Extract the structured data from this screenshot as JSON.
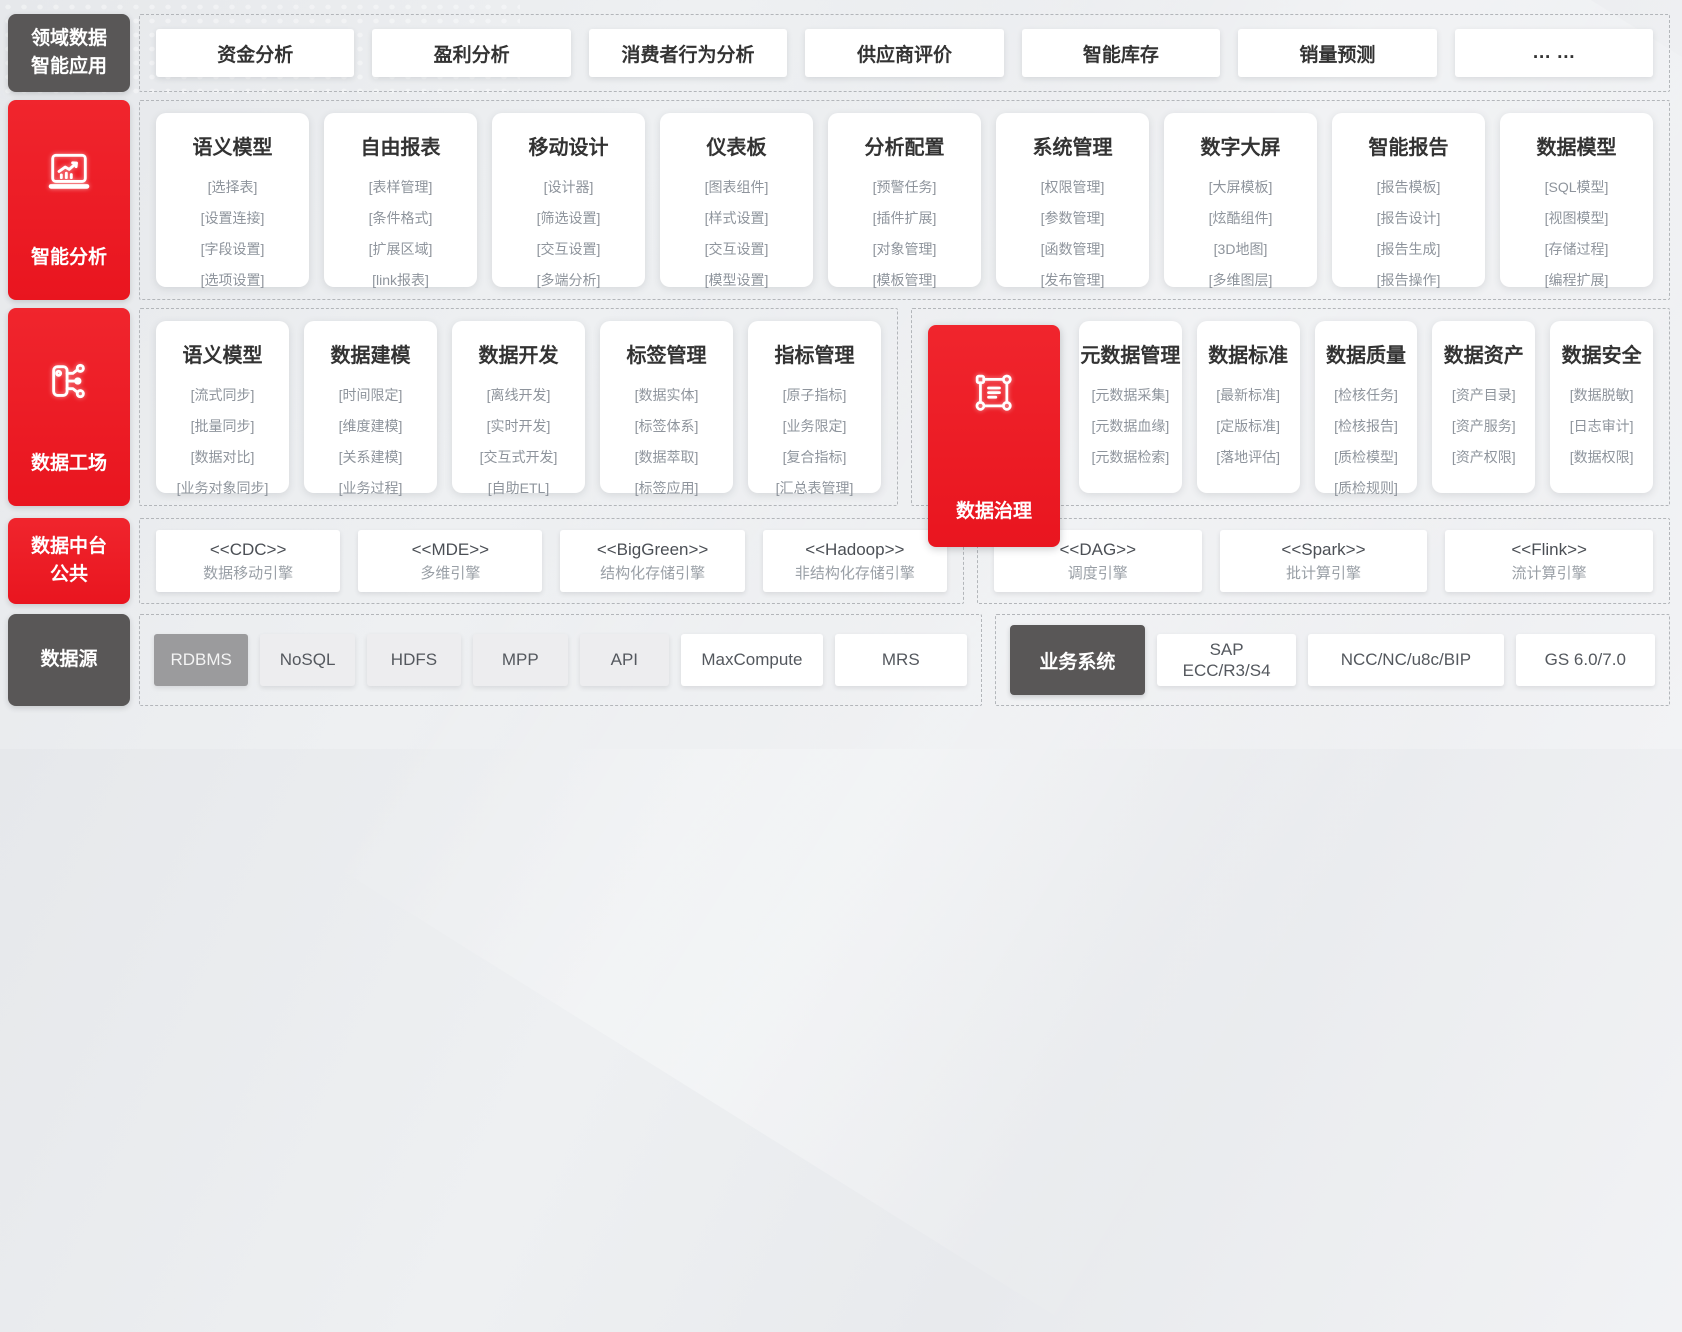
{
  "palette": {
    "accent_red": "#ec1c24",
    "dark_gray": "#595757",
    "source_highlight_gray": "#9b9b9d",
    "dashed_border": "#b3b6ba"
  },
  "app_row": {
    "label": "领域数据\n智能应用",
    "items": [
      "资金分析",
      "盈利分析",
      "消费者行为分析",
      "供应商评价",
      "智能库存",
      "销量预测",
      "… …"
    ]
  },
  "analysis_row": {
    "label": "智能分析",
    "icon": "analysis-chart-icon",
    "cards": [
      {
        "title": "语义模型",
        "items": [
          "[选择表]",
          "[设置连接]",
          "[字段设置]",
          "[选项设置]"
        ]
      },
      {
        "title": "自由报表",
        "items": [
          "[表样管理]",
          "[条件格式]",
          "[扩展区域]",
          "[link报表]"
        ]
      },
      {
        "title": "移动设计",
        "items": [
          "[设计器]",
          "[筛选设置]",
          "[交互设置]",
          "[多端分析]"
        ]
      },
      {
        "title": "仪表板",
        "items": [
          "[图表组件]",
          "[样式设置]",
          "[交互设置]",
          "[模型设置]"
        ]
      },
      {
        "title": "分析配置",
        "items": [
          "[预警任务]",
          "[插件扩展]",
          "[对象管理]",
          "[模板管理]"
        ]
      },
      {
        "title": "系统管理",
        "items": [
          "[权限管理]",
          "[参数管理]",
          "[函数管理]",
          "[发布管理]"
        ]
      },
      {
        "title": "数字大屏",
        "items": [
          "[大屏模板]",
          "[炫酷组件]",
          "[3D地图]",
          "[多维图层]"
        ]
      },
      {
        "title": "智能报告",
        "items": [
          "[报告模板]",
          "[报告设计]",
          "[报告生成]",
          "[报告操作]"
        ]
      },
      {
        "title": "数据模型",
        "items": [
          "[SQL模型]",
          "[视图模型]",
          "[存储过程]",
          "[编程扩展]"
        ]
      }
    ]
  },
  "factory_row": {
    "label": "数据工场",
    "icon": "data-factory-icon",
    "left_cards": [
      {
        "title": "语义模型",
        "items": [
          "[流式同步]",
          "[批量同步]",
          "[数据对比]",
          "[业务对象同步]"
        ]
      },
      {
        "title": "数据建模",
        "items": [
          "[时间限定]",
          "[维度建模]",
          "[关系建模]",
          "[业务过程]"
        ]
      },
      {
        "title": "数据开发",
        "items": [
          "[离线开发]",
          "[实时开发]",
          "[交互式开发]",
          "[自助ETL]"
        ]
      },
      {
        "title": "标签管理",
        "items": [
          "[数据实体]",
          "[标签体系]",
          "[数据萃取]",
          "[标签应用]"
        ]
      },
      {
        "title": "指标管理",
        "items": [
          "[原子指标]",
          "[业务限定]",
          "[复合指标]",
          "[汇总表管理]"
        ]
      }
    ],
    "governance_label": "数据治理",
    "governance_icon": "data-governance-icon",
    "right_cards": [
      {
        "title": "元数据管理",
        "items": [
          "[元数据采集]",
          "[元数据血缘]",
          "[元数据检索]"
        ]
      },
      {
        "title": "数据标准",
        "items": [
          "[最新标准]",
          "[定版标准]",
          "[落地评估]"
        ]
      },
      {
        "title": "数据质量",
        "items": [
          "[检核任务]",
          "[检核报告]",
          "[质检模型]",
          "[质检规则]"
        ]
      },
      {
        "title": "数据资产",
        "items": [
          "[资产目录]",
          "[资产服务]",
          "[资产权限]"
        ]
      },
      {
        "title": "数据安全",
        "items": [
          "[数据脱敏]",
          "[日志审计]",
          "[数据权限]"
        ]
      }
    ]
  },
  "platform_row": {
    "label": "数据中台\n公共",
    "left_engines": [
      {
        "name": "<<CDC>>",
        "desc": "数据移动引擎"
      },
      {
        "name": "<<MDE>>",
        "desc": "多维引擎"
      },
      {
        "name": "<<BigGreen>>",
        "desc": "结构化存储引擎"
      },
      {
        "name": "<<Hadoop>>",
        "desc": "非结构化存储引擎"
      }
    ],
    "right_engines": [
      {
        "name": "<<DAG>>",
        "desc": "调度引擎"
      },
      {
        "name": "<<Spark>>",
        "desc": "批计算引擎"
      },
      {
        "name": "<<Flink>>",
        "desc": "流计算引擎"
      }
    ]
  },
  "source_row": {
    "label": "数据源",
    "sources": [
      "RDBMS",
      "NoSQL",
      "HDFS",
      "MPP",
      "API",
      "MaxCompute",
      "MRS"
    ],
    "business_label": "业务系统",
    "business_systems": [
      "SAP\nECC/R3/S4",
      "NCC/NC/u8c/BIP",
      "GS 6.0/7.0"
    ]
  }
}
